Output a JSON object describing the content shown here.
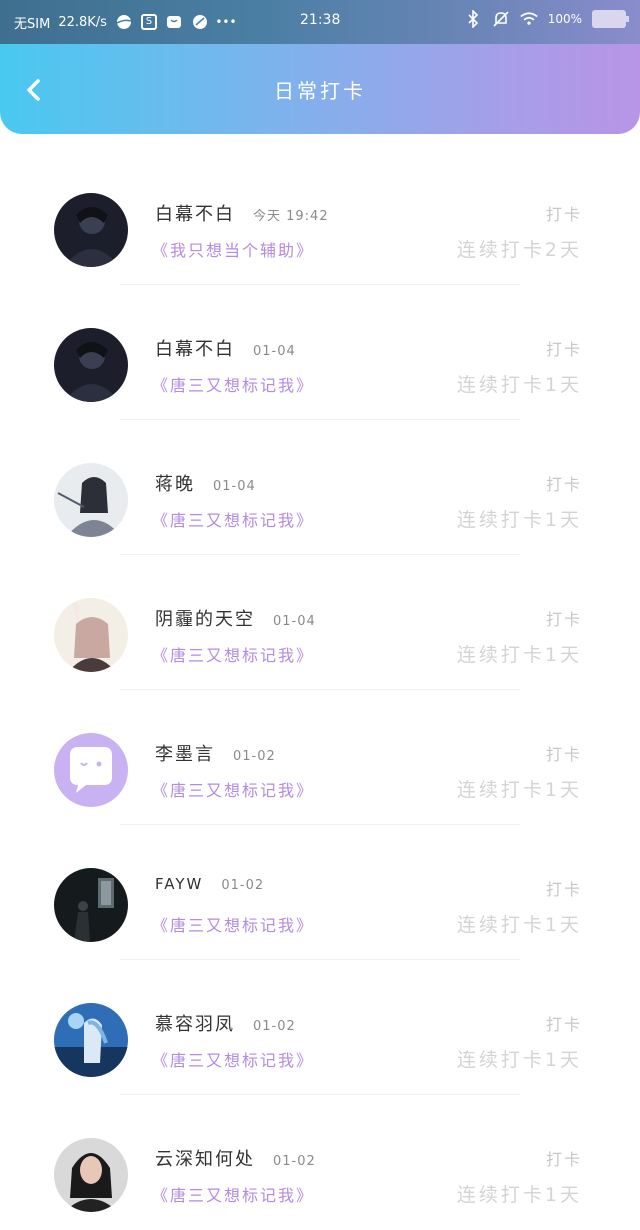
{
  "status_bar": {
    "carrier": "无SIM",
    "speed": "22.8K/s",
    "time": "21:38",
    "battery": "100%"
  },
  "header": {
    "title": "日常打卡"
  },
  "entries": [
    {
      "name": "白幕不白",
      "time": "今天 19:42",
      "quote": "《我只想当个辅助》",
      "action": "打卡",
      "streak": "连续打卡2天"
    },
    {
      "name": "白幕不白",
      "time": "01-04",
      "quote": "《唐三又想标记我》",
      "action": "打卡",
      "streak": "连续打卡1天"
    },
    {
      "name": "蒋晚",
      "time": "01-04",
      "quote": "《唐三又想标记我》",
      "action": "打卡",
      "streak": "连续打卡1天"
    },
    {
      "name": "阴霾的天空",
      "time": "01-04",
      "quote": "《唐三又想标记我》",
      "action": "打卡",
      "streak": "连续打卡1天"
    },
    {
      "name": "李墨言",
      "time": "01-02",
      "quote": "《唐三又想标记我》",
      "action": "打卡",
      "streak": "连续打卡1天"
    },
    {
      "name": "FAYW",
      "time": "01-02",
      "quote": "《唐三又想标记我》",
      "action": "打卡",
      "streak": "连续打卡1天"
    },
    {
      "name": "慕容羽凤",
      "time": "01-02",
      "quote": "《唐三又想标记我》",
      "action": "打卡",
      "streak": "连续打卡1天"
    },
    {
      "name": "云深知何处",
      "time": "01-02",
      "quote": "《唐三又想标记我》",
      "action": "打卡",
      "streak": "连续打卡1天"
    }
  ],
  "colors": {
    "accent_quote": "#b58be0",
    "header_start": "#49c9f0",
    "header_end": "#b895e6"
  }
}
